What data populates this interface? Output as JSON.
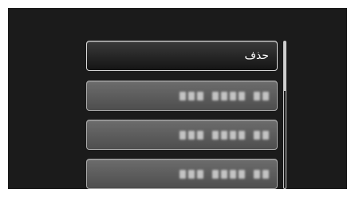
{
  "menu": {
    "items": [
      {
        "label": "حذف",
        "state": "selected"
      },
      {
        "label": "",
        "state": "obscured"
      },
      {
        "label": "",
        "state": "obscured"
      },
      {
        "label": "",
        "state": "obscured"
      }
    ]
  },
  "scrollbar": {
    "thumb_fraction_visible": 0.33,
    "position": "top"
  },
  "colors": {
    "background": "#1b1b1b",
    "selected_item": "#1e1e1e",
    "normal_item": "#5e5e5e",
    "border": "#a8a8a8",
    "text": "#ffffff"
  }
}
